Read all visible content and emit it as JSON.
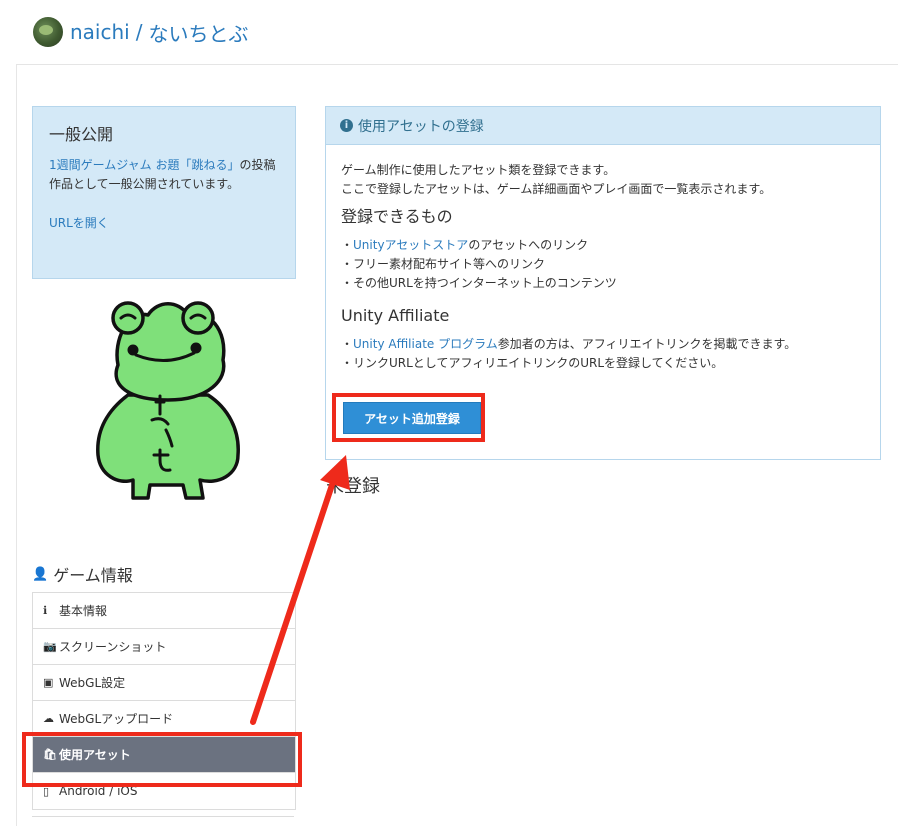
{
  "header": {
    "user": "naichi",
    "separator": "/",
    "game_title": "ないちとぶ"
  },
  "info_box": {
    "title": "一般公開",
    "link_text": "1週間ゲームジャム お題「跳ねる」",
    "body_text": "の投稿作品として一般公開されています。",
    "open_url": "URLを開く"
  },
  "sidebar": {
    "section_title": "ゲーム情報",
    "items": [
      {
        "label": "基本情報",
        "icon": "info-icon"
      },
      {
        "label": "スクリーンショット",
        "icon": "camera-icon"
      },
      {
        "label": "WebGL設定",
        "icon": "html5-icon"
      },
      {
        "label": "WebGLアップロード",
        "icon": "cloud-upload-icon"
      },
      {
        "label": "使用アセット",
        "icon": "shopping-bag-icon",
        "active": true
      },
      {
        "label": "Android / iOS",
        "icon": "mobile-icon"
      }
    ]
  },
  "panel": {
    "title": "使用アセットの登録",
    "intro_line1": "ゲーム制作に使用したアセット類を登録できます。",
    "intro_line2": "ここで登録したアセットは、ゲーム詳細画面やプレイ画面で一覧表示されます。",
    "registrable_heading": "登録できるもの",
    "item1_prefix": "・",
    "item1_link": "Unityアセットストア",
    "item1_suffix": "のアセットへのリンク",
    "item2": "・フリー素材配布サイト等へのリンク",
    "item3": "・その他URLを持つインターネット上のコンテンツ",
    "affiliate_heading": "Unity Affiliate",
    "aff1_prefix": "・",
    "aff1_link": "Unity Affiliate プログラム",
    "aff1_suffix": "参加者の方は、アフィリエイトリンクを掲載できます。",
    "aff2": "・リンクURLとしてアフィリエイトリンクのURLを登録してください。",
    "add_button": "アセット追加登録"
  },
  "unregistered_label": "未登録",
  "colors": {
    "link": "#2b7bbd",
    "info_bg": "#d4e9f7",
    "button": "#2f8fd6",
    "active_menu": "#6b7280",
    "annotation": "#ee2a1b"
  }
}
